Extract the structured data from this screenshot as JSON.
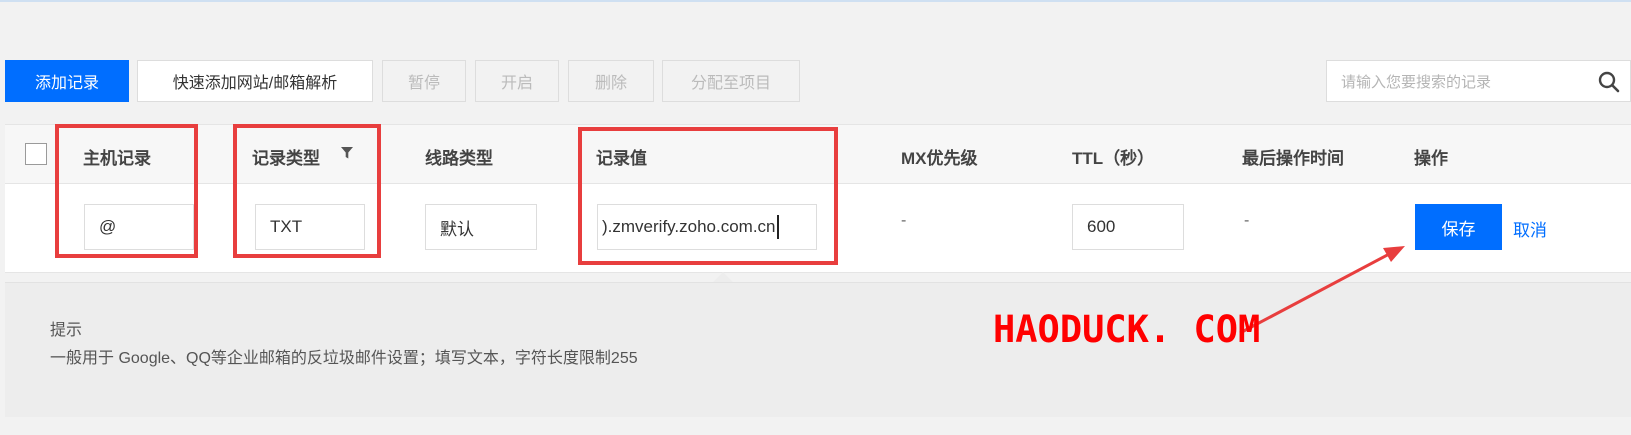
{
  "toolbar": {
    "add_record": "添加记录",
    "quick_add": "快速添加网站/邮箱解析",
    "pause": "暂停",
    "enable": "开启",
    "delete": "删除",
    "assign_project": "分配至项目",
    "search_placeholder": "请输入您要搜索的记录",
    "search_icon": "search-icon"
  },
  "table": {
    "headers": {
      "host": "主机记录",
      "type": "记录类型",
      "line": "线路类型",
      "value": "记录值",
      "mx": "MX优先级",
      "ttl": "TTL（秒）",
      "last_op": "最后操作时间",
      "actions": "操作"
    },
    "filter_icon": "filter-icon",
    "row": {
      "host": "@",
      "type": "TXT",
      "line": "默认",
      "value": ").zmverify.zoho.com.cn",
      "mx": "-",
      "ttl": "600",
      "last_op": "-",
      "save": "保存",
      "cancel": "取消"
    }
  },
  "tip": {
    "title": "提示",
    "text": "一般用于 Google、QQ等企业邮箱的反垃圾邮件设置；填写文本，字符长度限制255"
  },
  "watermark": "HAODUCK. COM",
  "colors": {
    "primary": "#006eff",
    "annotation_red": "#e83e3e",
    "watermark_red": "#ff0000"
  }
}
